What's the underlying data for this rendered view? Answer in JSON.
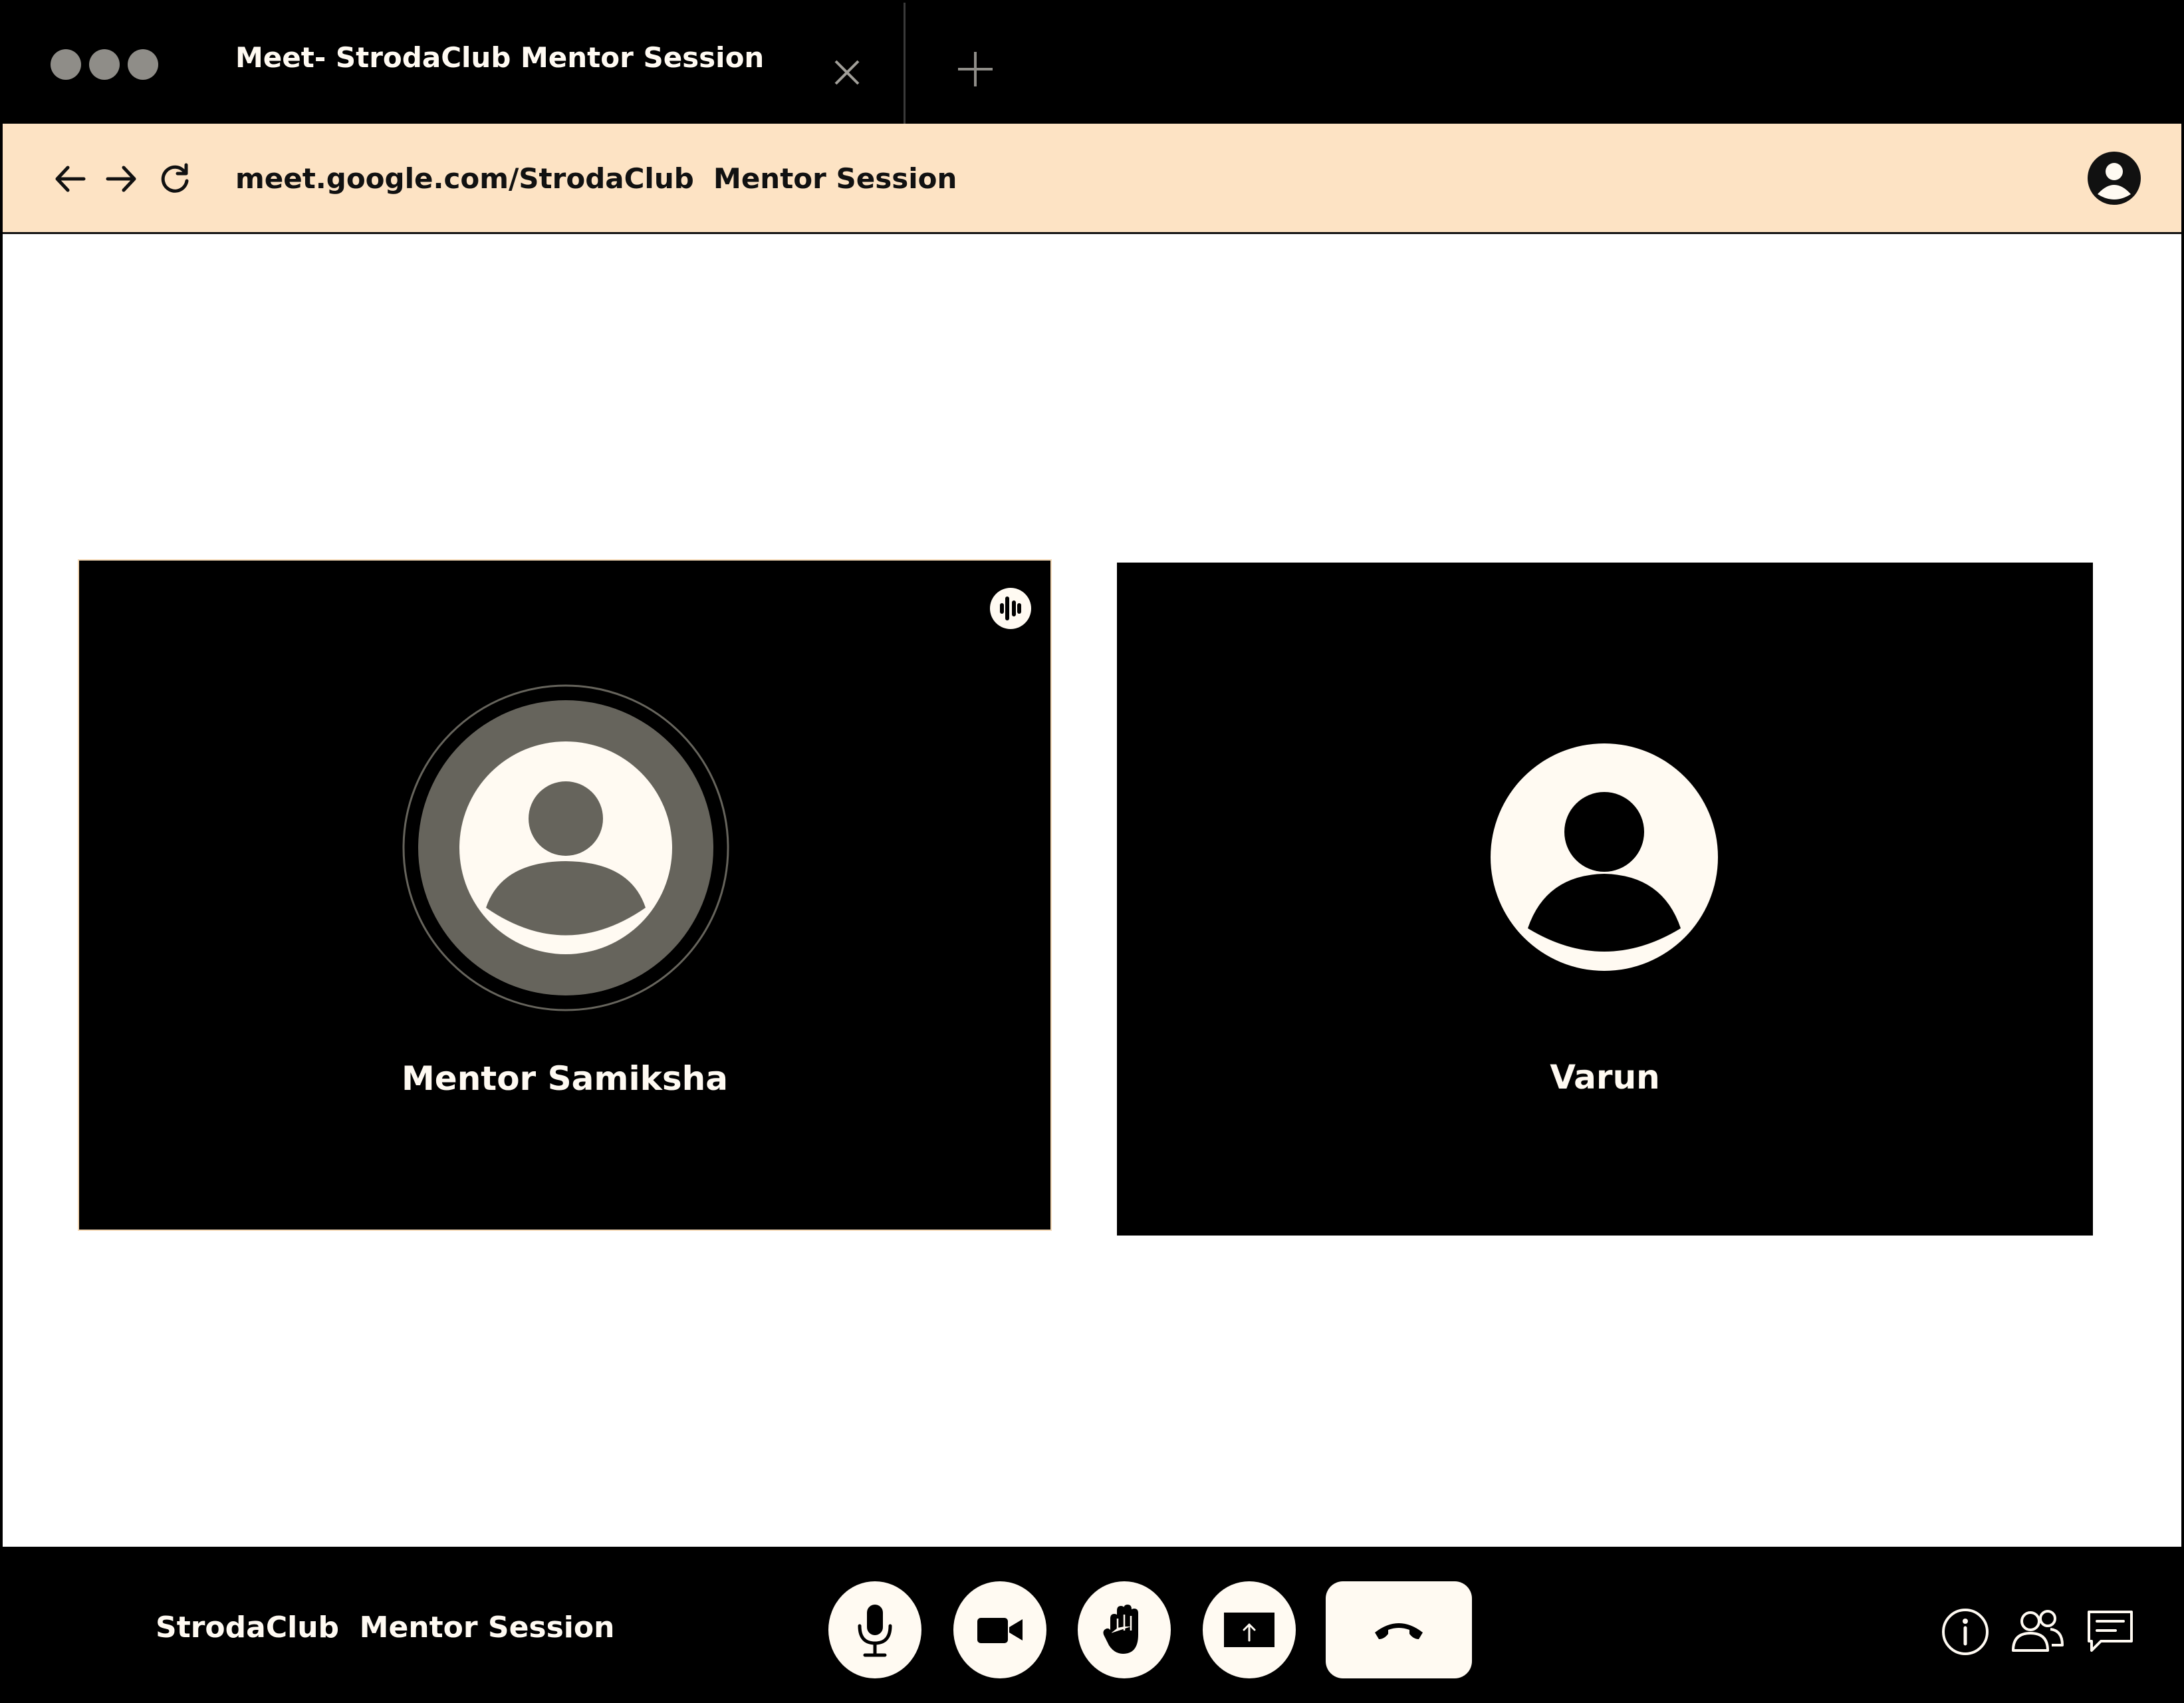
{
  "tab": {
    "title": "Meet- StrodaClub Mentor Session"
  },
  "address_bar": {
    "url": "meet.google.com/StrodaClub  Mentor Session"
  },
  "participants": [
    {
      "name": "Mentor Samiksha",
      "speaking": true
    },
    {
      "name": "Varun",
      "speaking": false
    }
  ],
  "control_bar": {
    "meeting_name": "StrodaClub  Mentor Session"
  },
  "colors": {
    "chrome": "#000000",
    "address_bar": "#fde3c4",
    "cream": "#fffaf2",
    "avatar_gray": "#66645c",
    "active_tile_border": "#f5d9b6"
  },
  "icons": {
    "window_dots": "traffic-dots-icon",
    "close_tab": "close-icon",
    "new_tab": "plus-icon",
    "back": "arrow-left-icon",
    "forward": "arrow-right-icon",
    "reload": "reload-icon",
    "profile": "account-icon",
    "speaking": "audio-level-icon",
    "mic": "microphone-icon",
    "camera": "camera-icon",
    "raise_hand": "hand-icon",
    "present": "present-screen-icon",
    "end_call": "phone-hangup-icon",
    "info": "info-icon",
    "people": "people-icon",
    "chat": "chat-icon"
  }
}
